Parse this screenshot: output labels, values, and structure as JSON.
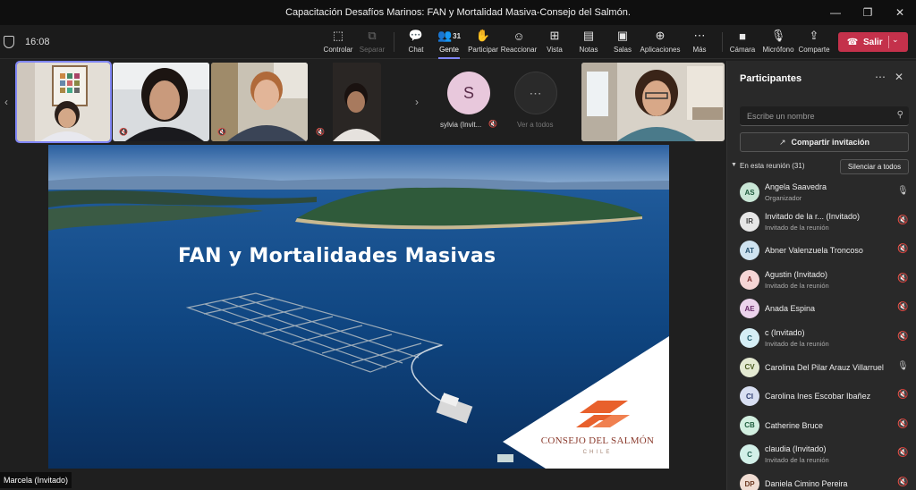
{
  "window": {
    "title": "Capacitación Desafíos Marinos: FAN y Mortalidad Masiva-Consejo del Salmón.",
    "minimize": "—",
    "restore": "❐",
    "close": "✕"
  },
  "toolbar": {
    "time": "16:08",
    "buttons": [
      {
        "id": "controlar",
        "label": "Controlar",
        "icon": "⬚"
      },
      {
        "id": "separar",
        "label": "Separar",
        "icon": "⧉"
      },
      {
        "id": "chat",
        "label": "Chat",
        "icon": "💬"
      },
      {
        "id": "gente",
        "label": "Gente",
        "icon": "👥",
        "count": "31"
      },
      {
        "id": "participar",
        "label": "Participar",
        "icon": "✋"
      },
      {
        "id": "reaccionar",
        "label": "Reaccionar",
        "icon": "☺"
      },
      {
        "id": "vista",
        "label": "Vista",
        "icon": "⊞"
      },
      {
        "id": "notas",
        "label": "Notas",
        "icon": "▤"
      },
      {
        "id": "salas",
        "label": "Salas",
        "icon": "▣"
      },
      {
        "id": "aplicaciones",
        "label": "Aplicaciones",
        "icon": "⊕"
      },
      {
        "id": "mas",
        "label": "Más",
        "icon": "⋯"
      },
      {
        "id": "camara",
        "label": "Cámara",
        "icon": "■"
      },
      {
        "id": "microfono",
        "label": "Micrófono",
        "icon": "🎙"
      },
      {
        "id": "compartir",
        "label": "Comparte",
        "icon": "⇪"
      }
    ],
    "leave_label": "Salir",
    "leave_icon": "☎",
    "leave_chevron": "⌄"
  },
  "strip": {
    "prev": "‹",
    "next": "›",
    "avatar_initial": "S",
    "avatar_name": "sylvia (Invit...",
    "see_all_icon": "⋯",
    "see_all_label": "Ver a todos",
    "mic_off": "🔇"
  },
  "slide": {
    "title": "FAN y Mortalidades Masivas",
    "brand": "CONSEJO DEL SALMÓN",
    "brand_sub": "CHILE",
    "presenter": "Marcela (Invitado)"
  },
  "panel": {
    "title": "Participantes",
    "more": "⋯",
    "close": "✕",
    "search_placeholder": "Escribe un nombre",
    "share_label": "Compartir invitación",
    "section_label": "En esta reunión (31)",
    "mute_all_label": "Silenciar a todos",
    "participants": [
      {
        "initials": "AS",
        "name": "Angela Saavedra",
        "role": "Organizador",
        "mic": "on",
        "bg": "#c9e6d6",
        "fg": "#1f5c3e"
      },
      {
        "initials": "IR",
        "name": "Invitado de la r... (Invitado)",
        "role": "Invitado de la reunión",
        "mic": "off",
        "bg": "#e6e6e6",
        "fg": "#444"
      },
      {
        "initials": "AT",
        "name": "Abner Valenzuela Troncoso",
        "role": "",
        "mic": "off",
        "bg": "#cfe3f0",
        "fg": "#24506e"
      },
      {
        "initials": "A",
        "name": "Agustin (Invitado)",
        "role": "Invitado de la reunión",
        "mic": "off",
        "bg": "#f5d5d5",
        "fg": "#7a2a2a"
      },
      {
        "initials": "AE",
        "name": "Anada Espina",
        "role": "",
        "mic": "off",
        "bg": "#ecd3ec",
        "fg": "#6a2c6a"
      },
      {
        "initials": "C",
        "name": "c (Invitado)",
        "role": "Invitado de la reunión",
        "mic": "off",
        "bg": "#d5eef5",
        "fg": "#1c5a6a"
      },
      {
        "initials": "CV",
        "name": "Carolina Del Pilar Arauz Villarruel",
        "role": "",
        "mic": "on",
        "bg": "#e4ead2",
        "fg": "#4a5a20"
      },
      {
        "initials": "CI",
        "name": "Carolina Ines Escobar Ibañez",
        "role": "",
        "mic": "off",
        "bg": "#d8dff2",
        "fg": "#2c3a6e"
      },
      {
        "initials": "CB",
        "name": "Catherine Bruce",
        "role": "",
        "mic": "off",
        "bg": "#d2efe0",
        "fg": "#1f5e3e"
      },
      {
        "initials": "C",
        "name": "claudia (Invitado)",
        "role": "Invitado de la reunión",
        "mic": "off",
        "bg": "#d2f0e8",
        "fg": "#1f5e4e"
      },
      {
        "initials": "DP",
        "name": "Daniela Cimino Pereira",
        "role": "",
        "mic": "off",
        "bg": "#f0dcd2",
        "fg": "#6e3a22"
      }
    ],
    "mic_on_icon": "🎙",
    "mic_off_icon": "🔇"
  }
}
